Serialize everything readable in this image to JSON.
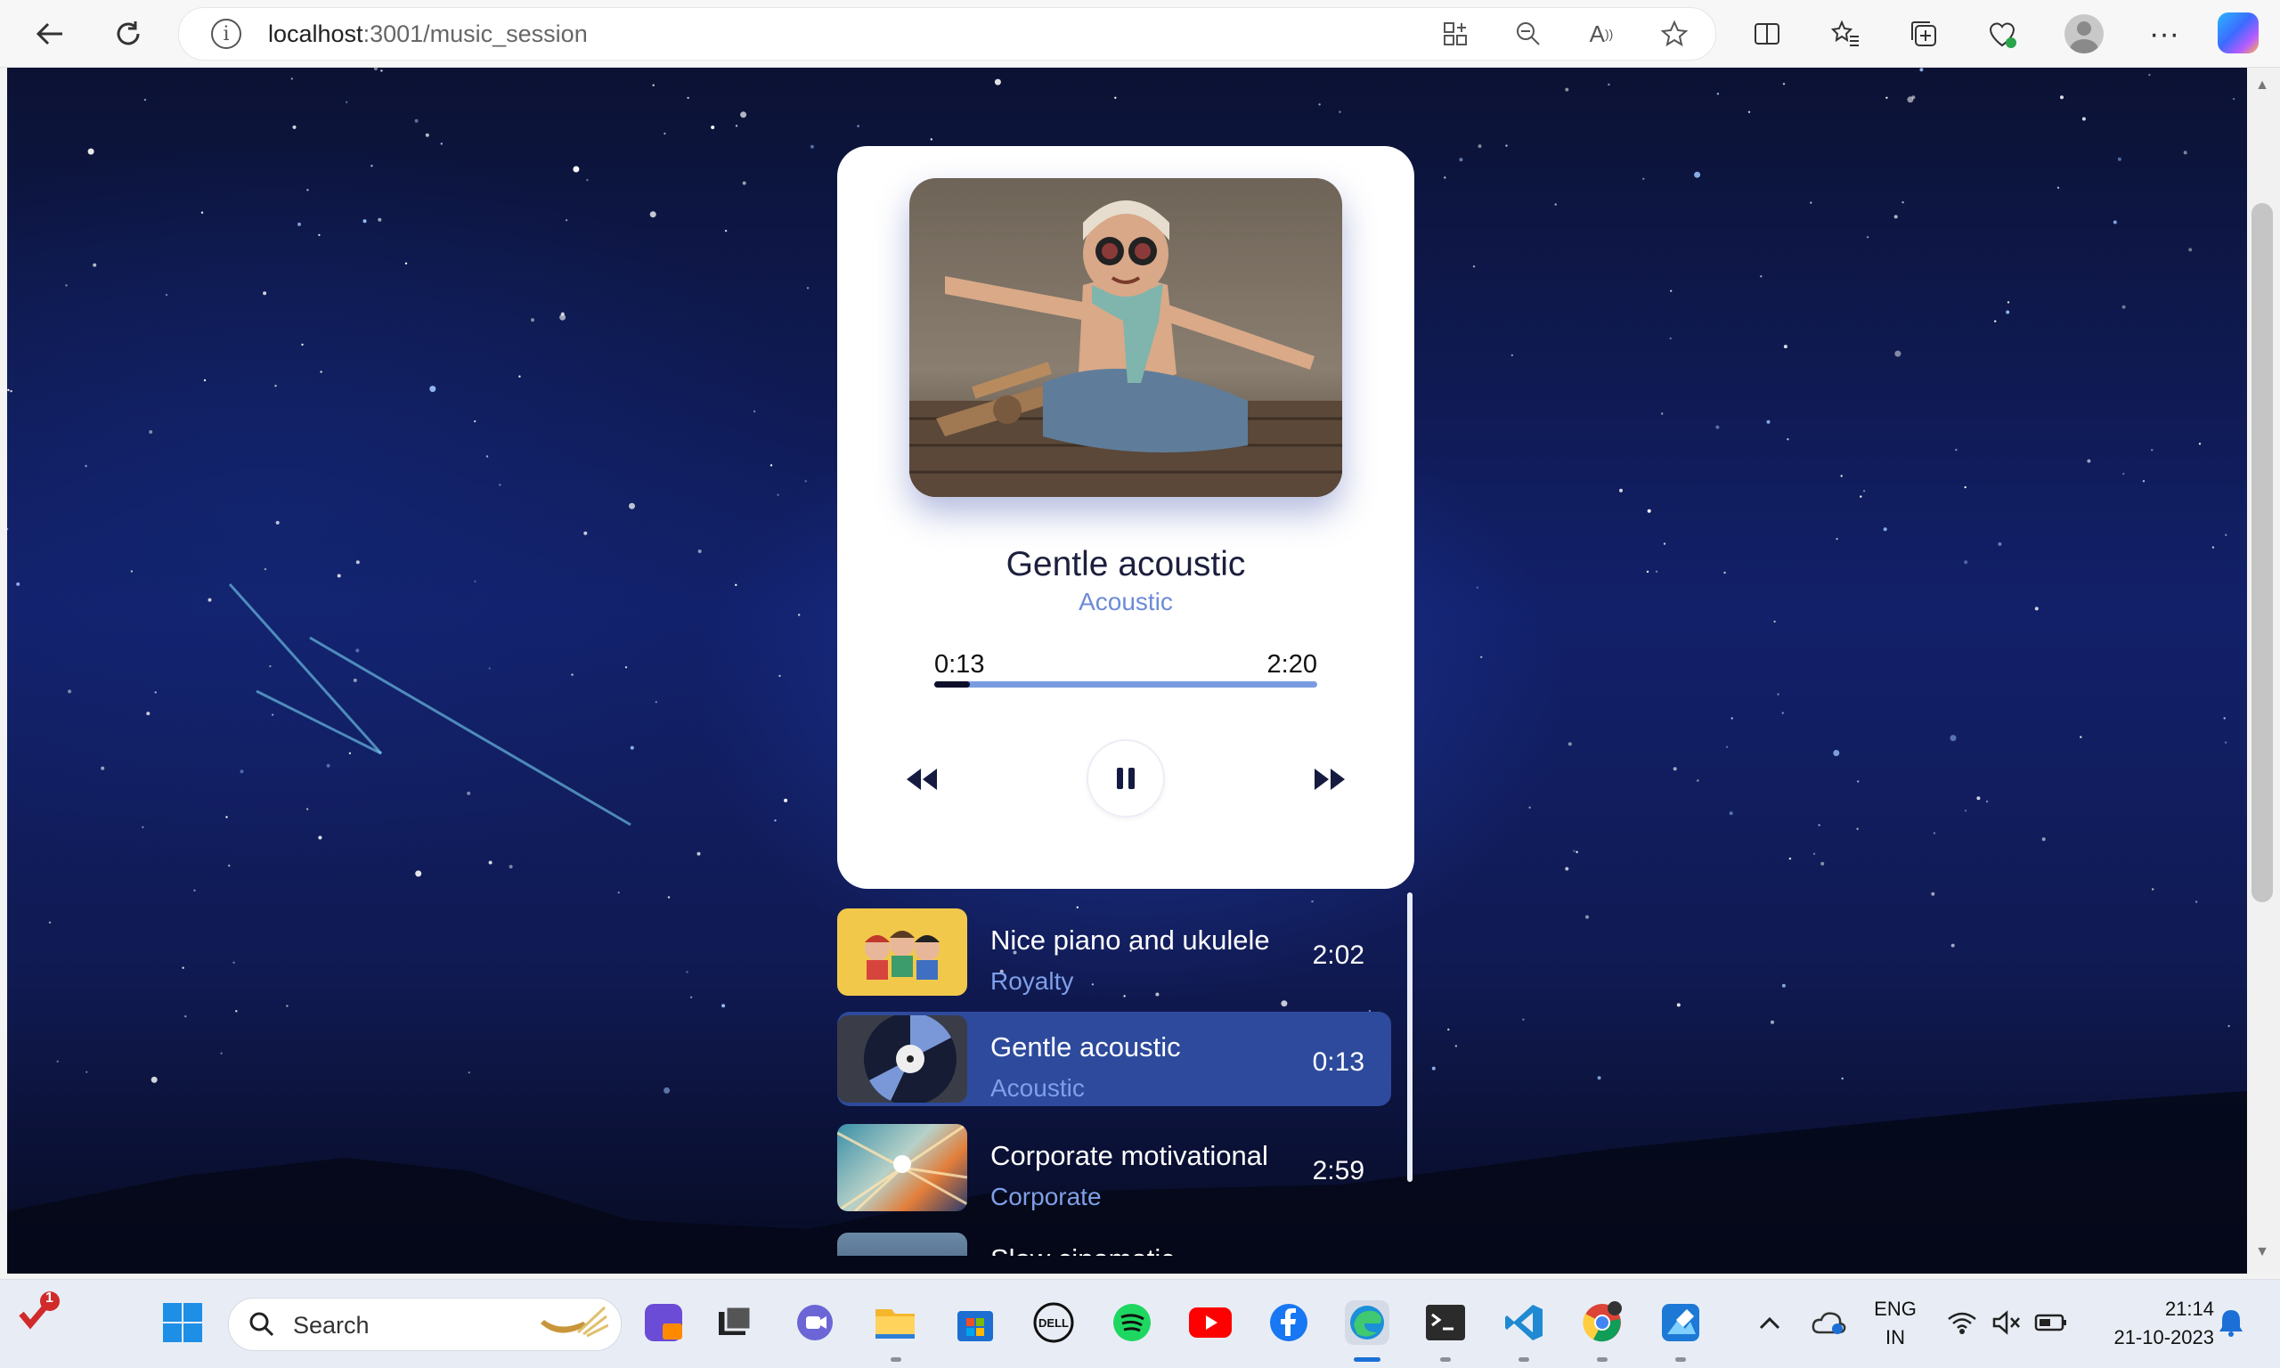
{
  "browser": {
    "url_host": "localhost",
    "url_path": ":3001/music_session"
  },
  "player": {
    "title": "Gentle acoustic",
    "artist": "Acoustic",
    "current_time": "0:13",
    "total_time": "2:20",
    "progress_fraction": 0.093,
    "state": "playing"
  },
  "playlist": [
    {
      "title": "Nice piano and ukulele",
      "artist": "Royalty",
      "duration": "2:02",
      "active": false
    },
    {
      "title": "Gentle acoustic",
      "artist": "Acoustic",
      "duration": "0:13",
      "active": true
    },
    {
      "title": "Corporate motivational",
      "artist": "Corporate",
      "duration": "2:59",
      "active": false
    },
    {
      "title": "Slow cinematic",
      "artist": "",
      "duration": "",
      "active": false
    }
  ],
  "taskbar": {
    "search_placeholder": "Search",
    "notification_count": "1",
    "language_line1": "ENG",
    "language_line2": "IN",
    "time": "21:14",
    "date": "21-10-2023"
  },
  "colors": {
    "accent": "#6d8bd8",
    "active_row": "#2d4a9d",
    "background": "#12206a"
  }
}
